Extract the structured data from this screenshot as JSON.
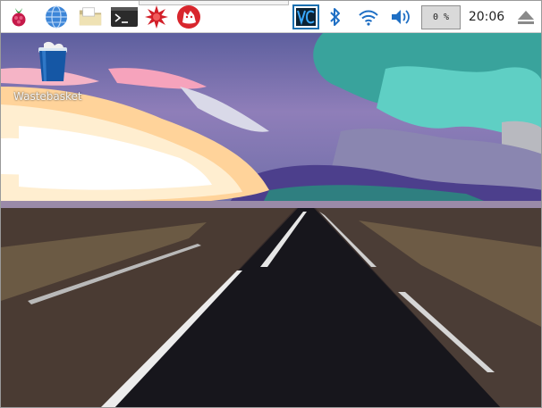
{
  "taskbar": {
    "launchers": [
      {
        "icon": "raspberry-menu-icon"
      },
      {
        "icon": "web-browser-globe-icon"
      },
      {
        "icon": "file-manager-folder-icon"
      },
      {
        "icon": "terminal-icon"
      },
      {
        "icon": "wolfram-star-icon"
      },
      {
        "icon": "mathematica-wolf-icon"
      }
    ],
    "tray": {
      "vnc_icon": "vnc-icon",
      "bluetooth_icon": "bluetooth-icon",
      "wifi_icon": "wifi-icon",
      "volume_icon": "volume-icon",
      "cpu_usage": "0 %",
      "clock": "20:06",
      "eject_icon": "eject-icon"
    }
  },
  "desktop": {
    "icons": [
      {
        "label": "Wastebasket",
        "icon": "wastebasket-icon"
      }
    ]
  },
  "colors": {
    "taskbar_bg": "#ffffff",
    "accent_blue": "#1a6fb0",
    "raspberry_red": "#c51a4a"
  }
}
